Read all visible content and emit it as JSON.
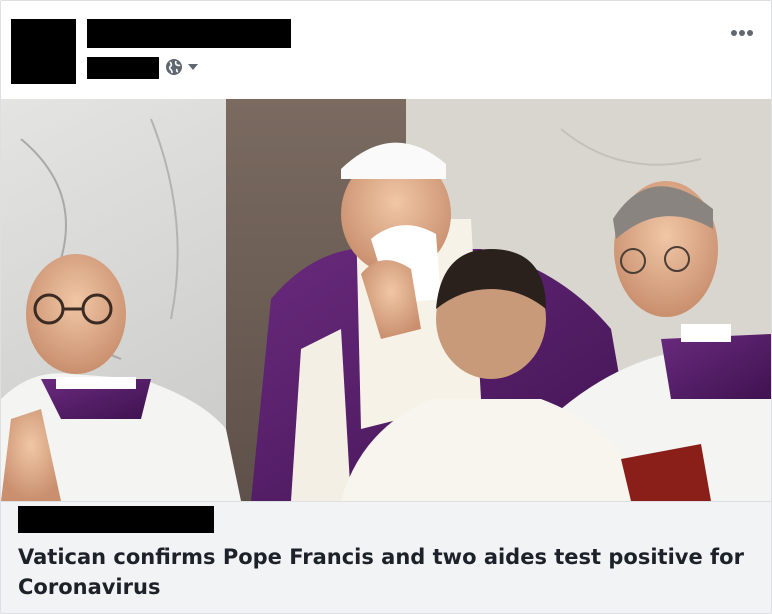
{
  "post": {
    "headline": "Vatican confirms Pope Francis and two aides test positive for Coronavirus"
  },
  "icons": {
    "audience": "globe-icon",
    "audience_menu": "caret-down-icon",
    "options": "more-options-icon"
  },
  "colors": {
    "footer_background": "#f2f3f5",
    "headline_text": "#1d2129",
    "icon_gray": "#606770",
    "vestment_purple": "#5a1f6b"
  }
}
